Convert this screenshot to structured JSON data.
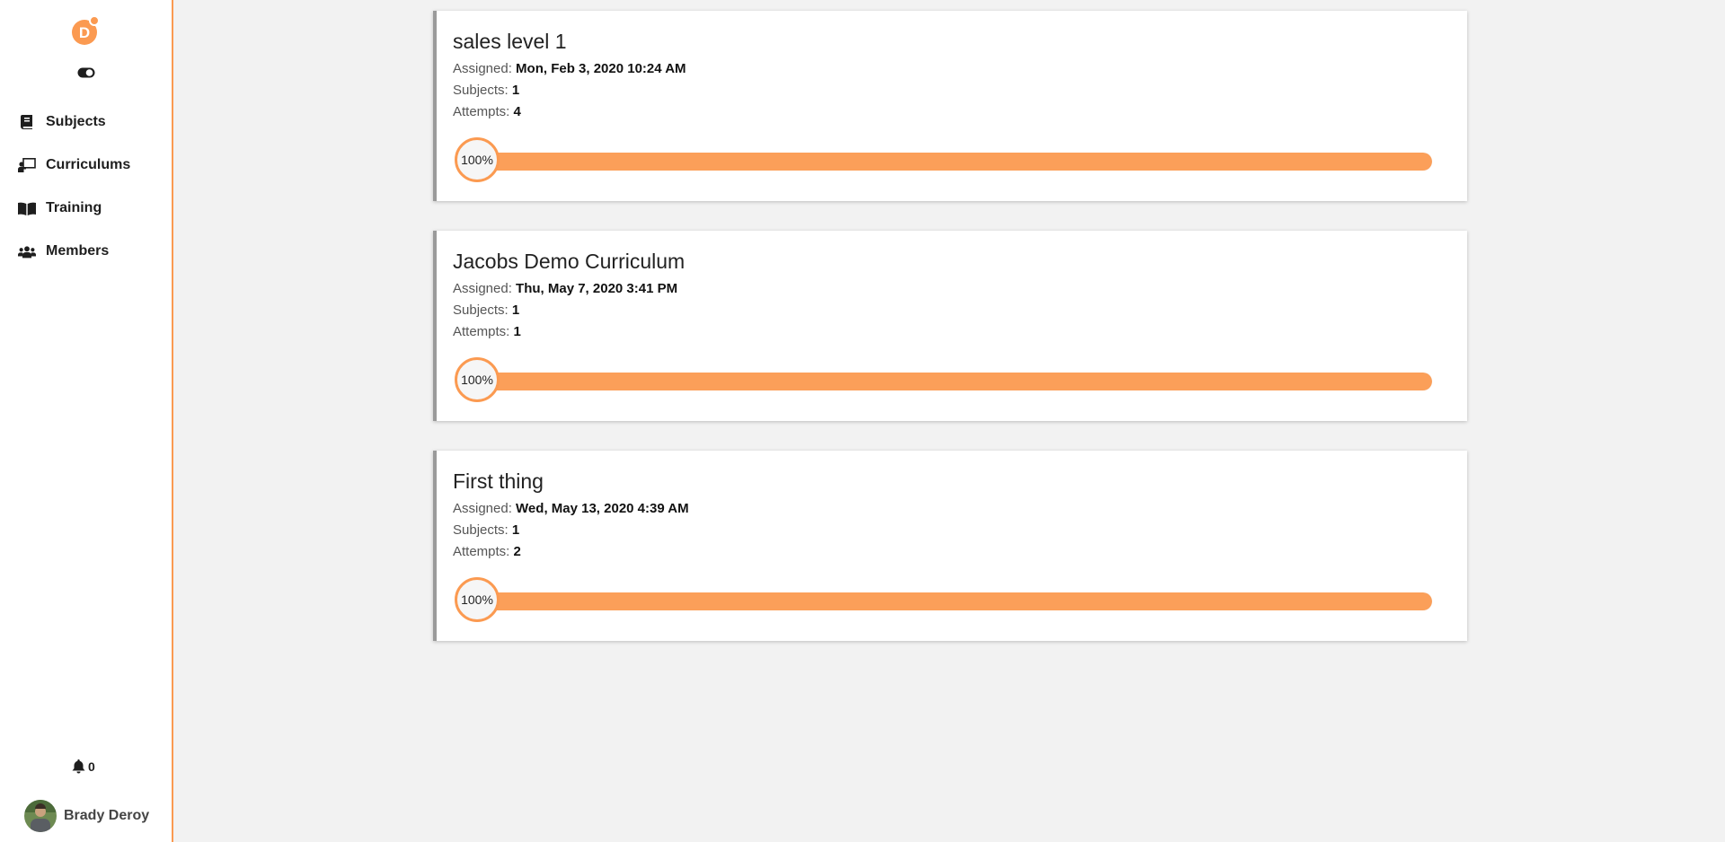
{
  "sidebar": {
    "logo_letter": "D",
    "nav": [
      {
        "label": "Subjects",
        "icon": "book-icon"
      },
      {
        "label": "Curriculums",
        "icon": "chalkboard-teacher-icon"
      },
      {
        "label": "Training",
        "icon": "open-book-icon"
      },
      {
        "label": "Members",
        "icon": "users-icon"
      }
    ],
    "notifications": {
      "count": "0",
      "icon": "bell-icon"
    },
    "user": {
      "name": "Brady Deroy"
    }
  },
  "labels": {
    "assigned": "Assigned:",
    "subjects": "Subjects:",
    "attempts": "Attempts:"
  },
  "cards": [
    {
      "title": "sales level 1",
      "assigned": "Mon, Feb 3, 2020 10:24 AM",
      "subjects": "1",
      "attempts": "4",
      "progress_label": "100%",
      "progress": 1.0
    },
    {
      "title": "Jacobs Demo Curriculum",
      "assigned": "Thu, May 7, 2020 3:41 PM",
      "subjects": "1",
      "attempts": "1",
      "progress_label": "100%",
      "progress": 1.0
    },
    {
      "title": "First thing",
      "assigned": "Wed, May 13, 2020 4:39 AM",
      "subjects": "1",
      "attempts": "2",
      "progress_label": "100%",
      "progress": 1.0
    }
  ],
  "colors": {
    "accent": "#fb9a51",
    "progress_fill": "#fb9f59",
    "card_border": "#9a9a9a",
    "background": "#f2f2f2"
  }
}
